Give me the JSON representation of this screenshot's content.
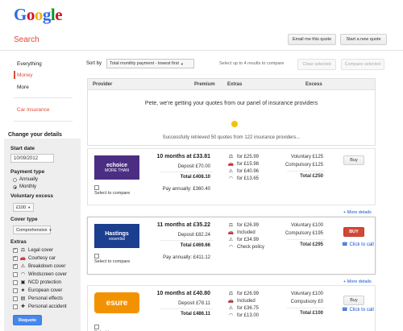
{
  "logo": {
    "letters": [
      "G",
      "o",
      "o",
      "g",
      "l",
      "e"
    ],
    "colors": [
      "#3369e8",
      "#d50f25",
      "#eeb211",
      "#3369e8",
      "#009925",
      "#d50f25"
    ]
  },
  "header": {
    "title": "Search",
    "email_button": "Email me this quote",
    "new_quote_button": "Start a new quote"
  },
  "nav": {
    "items": [
      "Everything",
      "Money",
      "More"
    ],
    "active": "Money",
    "sub_item": "Car insurance"
  },
  "sidebar": {
    "title": "Change your details",
    "start_date_label": "Start date",
    "start_date_value": "10/09/2012",
    "payment_label": "Payment type",
    "payment_options": [
      "Annually",
      "Monthly"
    ],
    "payment_selected": "Monthly",
    "excess_label": "Voluntary excess",
    "excess_value": "£100",
    "cover_label": "Cover type",
    "cover_value": "Comprehensive",
    "extras_label": "Extras",
    "extras": [
      {
        "label": "Legal cover",
        "checked": true,
        "icon": "gavel-icon",
        "glyph": "⚖"
      },
      {
        "label": "Courtesy car",
        "checked": true,
        "icon": "car-icon",
        "glyph": "🚗"
      },
      {
        "label": "Breakdown cover",
        "checked": true,
        "icon": "tow-truck-icon",
        "glyph": "⚠"
      },
      {
        "label": "Windscreen cover",
        "checked": false,
        "icon": "windscreen-icon",
        "glyph": "◠"
      },
      {
        "label": "NCD protection",
        "checked": false,
        "icon": "ncd-icon",
        "glyph": "▣"
      },
      {
        "label": "European cover",
        "checked": false,
        "icon": "european-flag-icon",
        "glyph": "★"
      },
      {
        "label": "Personal effects",
        "checked": false,
        "icon": "briefcase-icon",
        "glyph": "▤"
      },
      {
        "label": "Personal accident",
        "checked": false,
        "icon": "first-aid-icon",
        "glyph": "✚"
      }
    ],
    "requote_button": "Requote"
  },
  "toolbar": {
    "sort_label": "Sort by",
    "sort_value": "Total monthly payment - lowest first",
    "hint": "Select up to 4 results to compare",
    "clear_button": "Clear selected",
    "compare_button": "Compare selected"
  },
  "table": {
    "headers": [
      "Provider",
      "Premium",
      "Extras",
      "Excess"
    ]
  },
  "loading": {
    "message": "Pete, we're getting your quotes from our panel of insurance providers",
    "status": "Successfully retrieved 50 quotes from 122 insurance providers...",
    "spinner_color": "#f4c20d"
  },
  "quotes": [
    {
      "provider": "echoice",
      "logo_lines": [
        "echoice",
        "MORE THAN"
      ],
      "logo_bg": "#4b2e83",
      "months": "10 months at £33.81",
      "deposit": "Deposit £70.00",
      "total": "Total £408.10",
      "annual": null,
      "extras": [
        "for £25.99",
        "for £15.98",
        "for £40.96",
        "for £13.65"
      ],
      "vol_excess": "Voluntary £125",
      "comp_excess": "Compulsory £125",
      "total_excess": "Total £250",
      "buy_label": "Buy",
      "buy_red": false,
      "call_label": null,
      "compare_label": "Select to compare",
      "pay_annually": "Pay annually: £360.40",
      "more": "+ More details"
    },
    {
      "provider": "Hastings essential",
      "logo_lines": [
        "Hastings",
        "essential"
      ],
      "logo_bg": "#1b3e8f",
      "months": "11 months at £35.22",
      "deposit": "Deposit £82.24",
      "total": "Total £469.66",
      "extras": [
        "for £26.99",
        "Included",
        "for £34.99",
        "Check policy"
      ],
      "vol_excess": "Voluntary £100",
      "comp_excess": "Compulsory £195",
      "total_excess": "Total £295",
      "buy_label": "BUY",
      "buy_red": true,
      "call_label": "Click to call",
      "compare_label": "Select to compare",
      "pay_annually": "Pay annually: £411.12",
      "more": "+ More details"
    },
    {
      "provider": "esure",
      "logo_lines": [
        "esure"
      ],
      "logo_bg": "#f39200",
      "months": "10 months at £40.80",
      "deposit": "Deposit £78.11",
      "total": "Total £486.11",
      "extras": [
        "for £26.99",
        "Included",
        "for £36.75",
        "for £13.00"
      ],
      "vol_excess": "Voluntary £100",
      "comp_excess": "Compulsory £0",
      "total_excess": "Total £100",
      "buy_label": "Buy",
      "buy_red": false,
      "call_label": "Click to call",
      "compare_label": "Select to compare",
      "pay_annually": "",
      "more": ""
    }
  ]
}
